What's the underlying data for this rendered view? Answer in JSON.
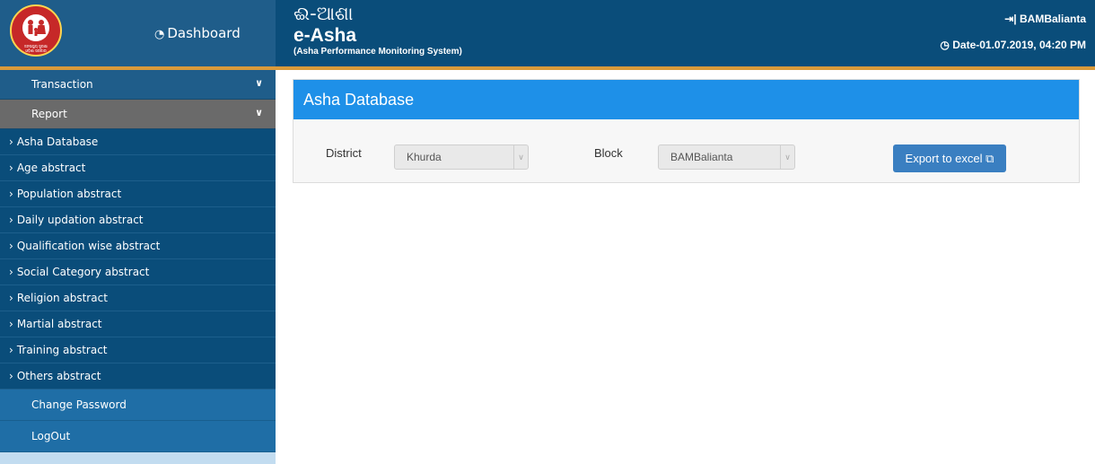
{
  "header": {
    "logo_ring_text": "NATIONAL RURAL HEALTH MISSION",
    "logo_tagline": "ଜନସାସ୍ଥ୍ୟ ସୁରକ୍ଷା",
    "logo_tagline2": "ଓଡ଼ିଶା ସରକାର",
    "dashboard_label": "Dashboard",
    "brand_odia": "ଈ-ଆଶା",
    "brand_title": "e-Asha",
    "brand_subtitle": "(Asha Performance Monitoring System)",
    "user_label": "BAMBalianta",
    "date_label": "Date-01.07.2019, 04:20 PM"
  },
  "sidebar": {
    "transaction_label": "Transaction",
    "report_label": "Report",
    "report_items": [
      "Asha Database",
      "Age abstract",
      "Population abstract",
      "Daily updation abstract",
      "Qualification wise abstract",
      "Social Category abstract",
      "Religion abstract",
      "Martial abstract",
      "Training abstract",
      "Others abstract"
    ],
    "change_password_label": "Change Password",
    "logout_label": "LogOut"
  },
  "main": {
    "panel_title": "Asha Database",
    "district_label": "District",
    "district_value": "Khurda",
    "block_label": "Block",
    "block_value": "BAMBalianta",
    "export_label": "Export to excel"
  },
  "colors": {
    "header_bg": "#0a4d7a",
    "accent_orange": "#d99a3a",
    "panel_head": "#1e90e8",
    "export_button": "#3a7fc1"
  },
  "icons": {
    "dashboard": "tachometer-icon",
    "user": "sign-in-icon",
    "date": "clock-icon",
    "export": "copy-icon"
  }
}
